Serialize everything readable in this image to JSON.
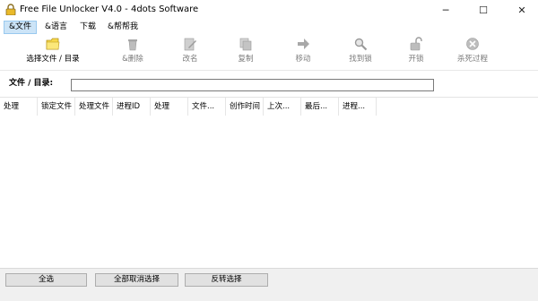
{
  "window": {
    "title": "Free File Unlocker V4.0 - 4dots Software",
    "minimize_glyph": "─",
    "maximize_glyph": "☐",
    "close_glyph": "✕"
  },
  "menu": {
    "items": [
      {
        "label": "&文件",
        "active": true
      },
      {
        "label": "&语言"
      },
      {
        "label": "下载"
      },
      {
        "label": "&帮帮我"
      }
    ]
  },
  "toolbar": {
    "buttons": [
      {
        "label": "选择文件 / 目录",
        "icon": "folder-icon",
        "enabled": true
      },
      {
        "label": "&删除",
        "icon": "trash-icon",
        "enabled": false
      },
      {
        "label": "改名",
        "icon": "rename-icon",
        "enabled": false
      },
      {
        "label": "复制",
        "icon": "copy-icon",
        "enabled": false
      },
      {
        "label": "移动",
        "icon": "move-arrow-icon",
        "enabled": false
      },
      {
        "label": "找到锁",
        "icon": "magnifier-icon",
        "enabled": false
      },
      {
        "label": "开锁",
        "icon": "unlock-icon",
        "enabled": false
      },
      {
        "label": "杀死过程",
        "icon": "kill-process-icon",
        "enabled": false
      }
    ],
    "dropdown_glyph": "▼"
  },
  "path": {
    "label": "文件 / 目录:",
    "value": "",
    "placeholder": ""
  },
  "grid": {
    "columns": [
      "处理",
      "锁定文件",
      "处理文件",
      "进程ID",
      "处理",
      "文件...",
      "创作时间",
      "上次...",
      "最后...",
      "进程..."
    ],
    "rows": []
  },
  "actions": {
    "select_all": "全选",
    "deselect_all": "全部取消选择",
    "invert_selection": "反转选择"
  },
  "colors": {
    "menu_active_bg": "#cce4f7",
    "folder_yellow": "#f6d84b",
    "disabled_icon": "#a8a8a8"
  }
}
